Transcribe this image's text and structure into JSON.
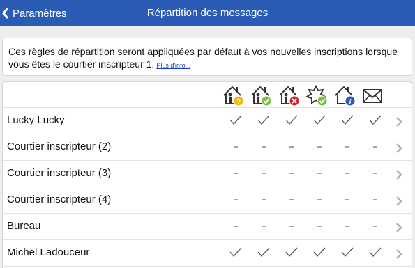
{
  "nav": {
    "back_label": "Paramètres",
    "title": "Répartition des messages",
    "bar_color": "#2a5bb5"
  },
  "info": {
    "text": "Ces règles de répartition seront appliquées par défaut à vos nouvelles inscriptions lorsque vous êtes le courtier inscripteur 1.",
    "link": "Plus d'info..."
  },
  "columns": [
    {
      "icon": "house-person-question-icon"
    },
    {
      "icon": "house-person-check-icon"
    },
    {
      "icon": "house-person-x-icon"
    },
    {
      "icon": "sold-badge-check-icon"
    },
    {
      "icon": "house-person-info-icon"
    },
    {
      "icon": "envelope-icon"
    }
  ],
  "rows": [
    {
      "label": "Lucky Lucky",
      "values": [
        "check",
        "check",
        "check",
        "check",
        "check",
        "check"
      ]
    },
    {
      "label": "Courtier inscripteur (2)",
      "values": [
        "dash",
        "dash",
        "dash",
        "dash",
        "dash",
        "dash"
      ]
    },
    {
      "label": "Courtier inscripteur (3)",
      "values": [
        "dash",
        "dash",
        "dash",
        "dash",
        "dash",
        "dash"
      ]
    },
    {
      "label": "Courtier inscripteur (4)",
      "values": [
        "dash",
        "dash",
        "dash",
        "dash",
        "dash",
        "dash"
      ]
    },
    {
      "label": "Bureau",
      "values": [
        "dash",
        "dash",
        "dash",
        "dash",
        "dash",
        "dash"
      ]
    },
    {
      "label": "Michel Ladouceur",
      "values": [
        "check",
        "check",
        "check",
        "check",
        "check",
        "check"
      ]
    }
  ]
}
